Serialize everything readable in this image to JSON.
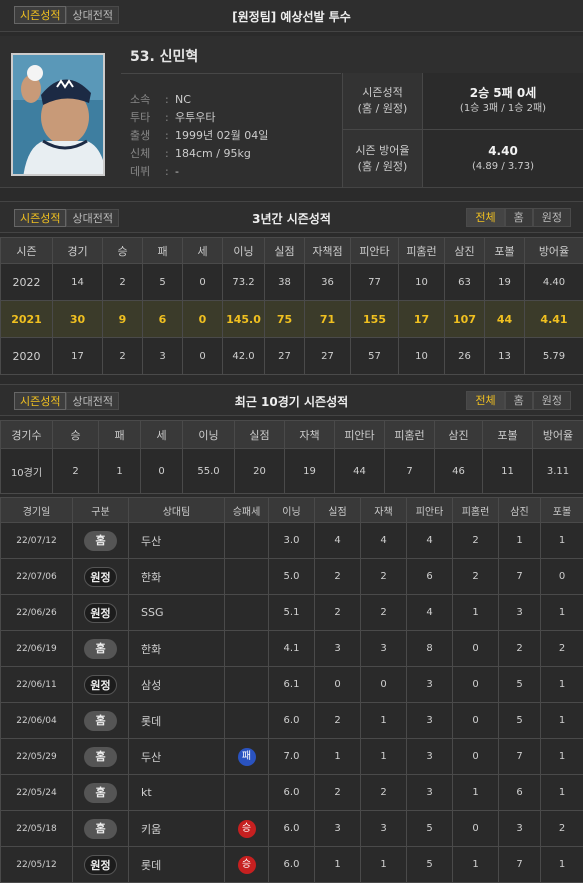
{
  "header": {
    "tabs": [
      "시즌성적",
      "상대전적"
    ],
    "active_tab": 0,
    "title": "[원정팀] 예상선발 투수"
  },
  "player": {
    "name": "53. 신민혁",
    "info": [
      {
        "k": "소속",
        "v": "NC"
      },
      {
        "k": "투타",
        "v": "우투우타"
      },
      {
        "k": "출생",
        "v": "1999년 02월 04일"
      },
      {
        "k": "신체",
        "v": "184cm / 95kg"
      },
      {
        "k": "데뷔",
        "v": "-"
      }
    ],
    "summary": [
      {
        "k1": "시즌성적",
        "k2": "(홈 / 원정)",
        "v1": "2승 5패 0세",
        "v2": "(1승 3패 / 1승 2패)"
      },
      {
        "k1": "시즌 방어율",
        "k2": "(홈 / 원정)",
        "v1": "4.40",
        "v2": "(4.89 / 3.73)"
      }
    ]
  },
  "three_year": {
    "tabs": [
      "시즌성적",
      "상대전적"
    ],
    "title": "3년간 시즌성적",
    "filters": [
      "전체",
      "홈",
      "원정"
    ],
    "active_filter": 0,
    "headers": [
      "시즌",
      "경기",
      "승",
      "패",
      "세",
      "이닝",
      "실점",
      "자책점",
      "피안타",
      "피홈런",
      "삼진",
      "포볼",
      "방어율"
    ],
    "rows": [
      [
        "2022",
        "14",
        "2",
        "5",
        "0",
        "73.2",
        "38",
        "36",
        "77",
        "10",
        "63",
        "19",
        "4.40"
      ],
      [
        "2021",
        "30",
        "9",
        "6",
        "0",
        "145.0",
        "75",
        "71",
        "155",
        "17",
        "107",
        "44",
        "4.41"
      ],
      [
        "2020",
        "17",
        "2",
        "3",
        "0",
        "42.0",
        "27",
        "27",
        "57",
        "10",
        "26",
        "13",
        "5.79"
      ]
    ],
    "highlight_row": 1
  },
  "recent": {
    "tabs": [
      "시즌성적",
      "상대전적"
    ],
    "title": "최근 10경기 시즌성적",
    "filters": [
      "전체",
      "홈",
      "원정"
    ],
    "active_filter": 0,
    "headers": [
      "경기수",
      "승",
      "패",
      "세",
      "이닝",
      "실점",
      "자책",
      "피안타",
      "피홈런",
      "삼진",
      "포볼",
      "방어율"
    ],
    "row": [
      "10경기",
      "2",
      "1",
      "0",
      "55.0",
      "20",
      "19",
      "44",
      "7",
      "46",
      "11",
      "3.11"
    ]
  },
  "game_log": {
    "headers": [
      "경기일",
      "구분",
      "상대팀",
      "승패세",
      "이닝",
      "실점",
      "자책",
      "피안타",
      "피홈런",
      "삼진",
      "포볼"
    ],
    "rows": [
      {
        "date": "22/07/12",
        "loc": "홈",
        "opp": "두산",
        "res": "",
        "ip": "3.0",
        "r": "4",
        "er": "4",
        "h": "4",
        "hr": "2",
        "so": "1",
        "bb": "1"
      },
      {
        "date": "22/07/06",
        "loc": "원정",
        "opp": "한화",
        "res": "",
        "ip": "5.0",
        "r": "2",
        "er": "2",
        "h": "6",
        "hr": "2",
        "so": "7",
        "bb": "0"
      },
      {
        "date": "22/06/26",
        "loc": "원정",
        "opp": "SSG",
        "res": "",
        "ip": "5.1",
        "r": "2",
        "er": "2",
        "h": "4",
        "hr": "1",
        "so": "3",
        "bb": "1"
      },
      {
        "date": "22/06/19",
        "loc": "홈",
        "opp": "한화",
        "res": "",
        "ip": "4.1",
        "r": "3",
        "er": "3",
        "h": "8",
        "hr": "0",
        "so": "2",
        "bb": "2"
      },
      {
        "date": "22/06/11",
        "loc": "원정",
        "opp": "삼성",
        "res": "",
        "ip": "6.1",
        "r": "0",
        "er": "0",
        "h": "3",
        "hr": "0",
        "so": "5",
        "bb": "1"
      },
      {
        "date": "22/06/04",
        "loc": "홈",
        "opp": "롯데",
        "res": "",
        "ip": "6.0",
        "r": "2",
        "er": "1",
        "h": "3",
        "hr": "0",
        "so": "5",
        "bb": "1"
      },
      {
        "date": "22/05/29",
        "loc": "홈",
        "opp": "두산",
        "res": "패",
        "ip": "7.0",
        "r": "1",
        "er": "1",
        "h": "3",
        "hr": "0",
        "so": "7",
        "bb": "1"
      },
      {
        "date": "22/05/24",
        "loc": "홈",
        "opp": "kt",
        "res": "",
        "ip": "6.0",
        "r": "2",
        "er": "2",
        "h": "3",
        "hr": "1",
        "so": "6",
        "bb": "1"
      },
      {
        "date": "22/05/18",
        "loc": "홈",
        "opp": "키움",
        "res": "승",
        "ip": "6.0",
        "r": "3",
        "er": "3",
        "h": "5",
        "hr": "0",
        "so": "3",
        "bb": "2"
      },
      {
        "date": "22/05/12",
        "loc": "원정",
        "opp": "롯데",
        "res": "승",
        "ip": "6.0",
        "r": "1",
        "er": "1",
        "h": "5",
        "hr": "1",
        "so": "7",
        "bb": "1"
      }
    ]
  },
  "colors": {
    "accent": "#f0c020",
    "win": "#c62020",
    "loss": "#2a53c0"
  }
}
